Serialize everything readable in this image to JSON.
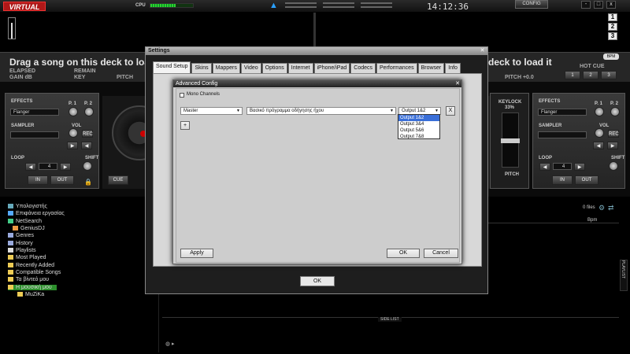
{
  "topbar": {
    "logo": "VIRTUAL DJ",
    "cpu_label": "CPU",
    "clock": "14:12:36",
    "config_label": "CONFIG",
    "win_buttons": [
      "-",
      "□",
      "x"
    ]
  },
  "track_buttons": [
    "1",
    "2",
    "3"
  ],
  "left_deck": {
    "drag_text": "Drag a song on this deck to load it",
    "elapsed": "ELAPSED",
    "gain": "GAIN dB",
    "remain": "REMAIN",
    "key": "KEY",
    "pitch": "PITCH"
  },
  "right_deck": {
    "drag_text": "deck to load it",
    "pitch": "PITCH +0.0",
    "bpm_badge": "BPM",
    "hot_cue_label": "HOT CUE",
    "hot_cues": [
      "1",
      "2",
      "3"
    ]
  },
  "left_panel": {
    "effects": "EFFECTS",
    "p1": "P. 1",
    "p2": "P. 2",
    "effect_value": "Flanger",
    "sampler": "SAMPLER",
    "vol": "VOL",
    "rec": "REC",
    "loop": "LOOP",
    "loop_value": "4",
    "shift": "SHIFT",
    "in_btn": "IN",
    "out_btn": "OUT",
    "cue_btn": "CUE"
  },
  "right_panel": {
    "effects": "EFFECTS",
    "p1": "P. 1",
    "p2": "P. 2",
    "effect_value": "Flanger",
    "sampler": "SAMPLER",
    "vol": "VOL",
    "rec": "REC",
    "loop": "LOOP",
    "loop_value": "4",
    "shift": "SHIFT",
    "in_btn": "IN",
    "out_btn": "OUT",
    "keylock": "KEYLOCK",
    "keylock_pct": "33%",
    "pitch": "PITCH"
  },
  "browser": {
    "tree": [
      "Υπολογιστής",
      "Επιφάνεια εργασίας",
      "NetSearch",
      "GeniusDJ",
      "Genres",
      "History",
      "Playlists",
      "Most Played",
      "Recently Added",
      "Compatible Songs",
      "Τα βίντεό μου",
      "Η μουσική μου",
      "MuZiKa"
    ],
    "files_count": "0 files",
    "bpm_col": "Bpm",
    "side_list": "SIDE LIST",
    "playlist_tab": "PLAYLIST"
  },
  "settings": {
    "title": "Settings",
    "tabs": [
      "Sound Setup",
      "Skins",
      "Mappers",
      "Video",
      "Options",
      "Internet",
      "iPhone/iPad",
      "Codecs",
      "Performances",
      "Browser",
      "Info"
    ],
    "ok": "OK"
  },
  "advanced": {
    "title": "Advanced Config",
    "mono_channels": "Mono Channels",
    "channel_value": "Master",
    "device_value": "Βασικό πρόγραμμα οδήγησης ήχου",
    "output_value": "Output 1&2",
    "remove_btn": "X",
    "add_btn": "+",
    "output_options": [
      "Output 1&2",
      "Output 3&4",
      "Output 5&6",
      "Output 7&8"
    ],
    "apply": "Apply",
    "ok": "OK",
    "cancel": "Cancel"
  },
  "colors": {
    "accent_red": "#b01818",
    "highlight_blue": "#3a6fd8",
    "tree_highlight": "#2c8f2c"
  }
}
